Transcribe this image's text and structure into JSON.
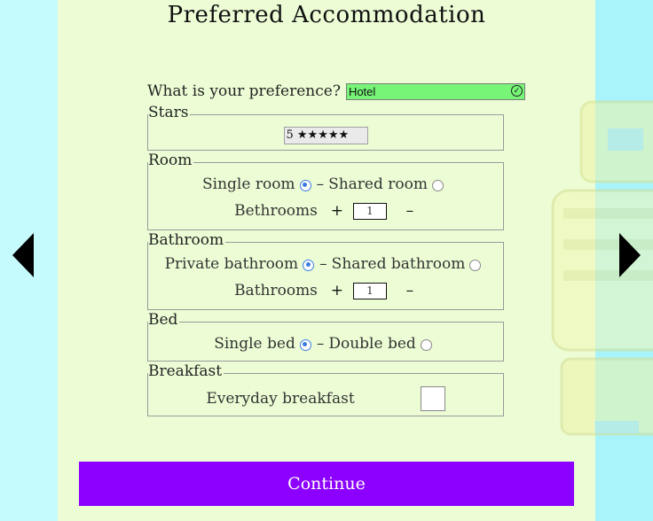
{
  "title": "Preferred Accommodation",
  "preference": {
    "label": "What is your preference?",
    "value": "Hotel"
  },
  "stars": {
    "legend": "Stars",
    "value": "5 ★★★★★"
  },
  "room": {
    "legend": "Room",
    "option_a": "Single room",
    "separator": "–",
    "option_b": "Shared room",
    "selected": "Single room",
    "counter_label": "Bethrooms",
    "plus": "+",
    "minus": "–",
    "count": "1"
  },
  "bathroom": {
    "legend": "Bathroom",
    "option_a": "Private bathroom",
    "separator": "–",
    "option_b": "Shared bathroom",
    "selected": "Private bathroom",
    "counter_label": "Bathrooms",
    "plus": "+",
    "minus": "–",
    "count": "1"
  },
  "bed": {
    "legend": "Bed",
    "option_a": "Single bed",
    "separator": "–",
    "option_b": "Double bed",
    "selected": "Single bed"
  },
  "breakfast": {
    "legend": "Breakfast",
    "label": "Everyday breakfast",
    "checked": false
  },
  "continue_label": "Continue",
  "colors": {
    "panel": "#ecfdd5",
    "background": "#c6fbfd",
    "accent": "#8c00ff",
    "select_ok": "#77f577",
    "radio": "#3b7ce0"
  },
  "icons": {
    "prev": "triangle-left-icon",
    "next": "triangle-right-icon",
    "valid": "check-circle-icon"
  }
}
